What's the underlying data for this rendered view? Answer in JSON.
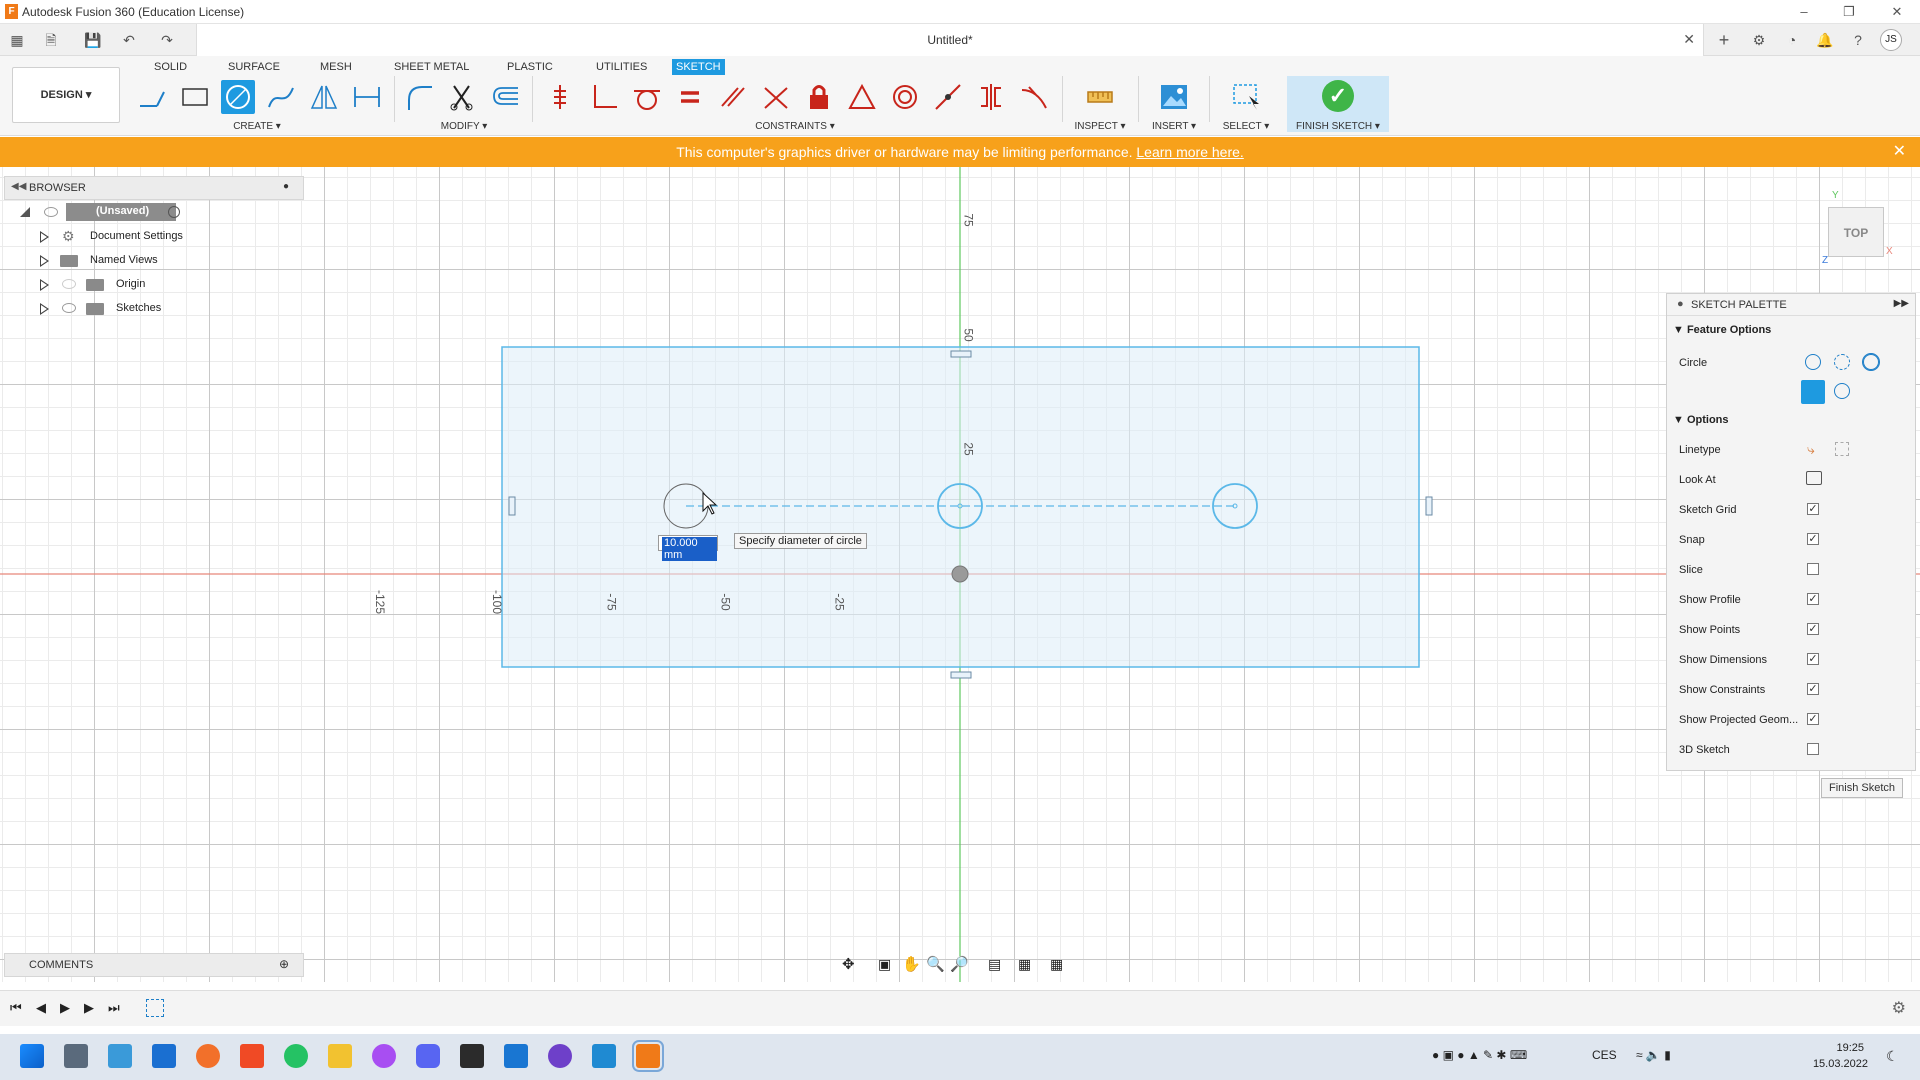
{
  "app_title": "Autodesk Fusion 360 (Education License)",
  "doc_name": "Untitled*",
  "user_initials": "JS",
  "toolbar": {
    "tabs": [
      "SOLID",
      "SURFACE",
      "MESH",
      "SHEET METAL",
      "PLASTIC",
      "UTILITIES",
      "SKETCH"
    ],
    "active_tab": "SKETCH",
    "workspace": "DESIGN ▾",
    "groups": {
      "create": "CREATE ▾",
      "modify": "MODIFY ▾",
      "constraints": "CONSTRAINTS ▾",
      "inspect": "INSPECT ▾",
      "insert": "INSERT ▾",
      "select": "SELECT ▾",
      "finish": "FINISH SKETCH ▾"
    }
  },
  "warning": {
    "text": "This computer's graphics driver or hardware may be limiting performance.",
    "link": "Learn more here."
  },
  "browser": {
    "title": "BROWSER",
    "root": "(Unsaved)",
    "items": [
      "Document Settings",
      "Named Views",
      "Origin",
      "Sketches"
    ]
  },
  "canvas": {
    "x_ticks": [
      "-125",
      "-100",
      "-75",
      "-50",
      "-25"
    ],
    "y_ticks": [
      "75",
      "50",
      "25"
    ],
    "dimension_value": "10.000 mm",
    "tooltip": "Specify diameter of circle"
  },
  "viewcube": {
    "face": "TOP",
    "axis_x": "X",
    "axis_y": "Y",
    "axis_z": "Z"
  },
  "palette": {
    "title": "SKETCH PALETTE",
    "feature_options": "Feature Options",
    "circle_label": "Circle",
    "options_title": "Options",
    "linetype": "Linetype",
    "look_at": "Look At",
    "rows": [
      {
        "label": "Sketch Grid",
        "checked": true
      },
      {
        "label": "Snap",
        "checked": true
      },
      {
        "label": "Slice",
        "checked": false
      },
      {
        "label": "Show Profile",
        "checked": true
      },
      {
        "label": "Show Points",
        "checked": true
      },
      {
        "label": "Show Dimensions",
        "checked": true
      },
      {
        "label": "Show Constraints",
        "checked": true
      },
      {
        "label": "Show Projected Geom...",
        "checked": true
      },
      {
        "label": "3D Sketch",
        "checked": false
      }
    ],
    "finish_button": "Finish Sketch"
  },
  "comments": {
    "title": "COMMENTS"
  },
  "taskbar": {
    "lang": "CES",
    "time": "19:25",
    "date": "15.03.2022"
  },
  "colors": {
    "accent": "#1e9ae0",
    "warning": "#f7a11b",
    "sketch_fill": "#e6f3fb",
    "sketch_line": "#5bb8e8",
    "x_axis": "#e8867a",
    "y_axis": "#5fc75f"
  }
}
